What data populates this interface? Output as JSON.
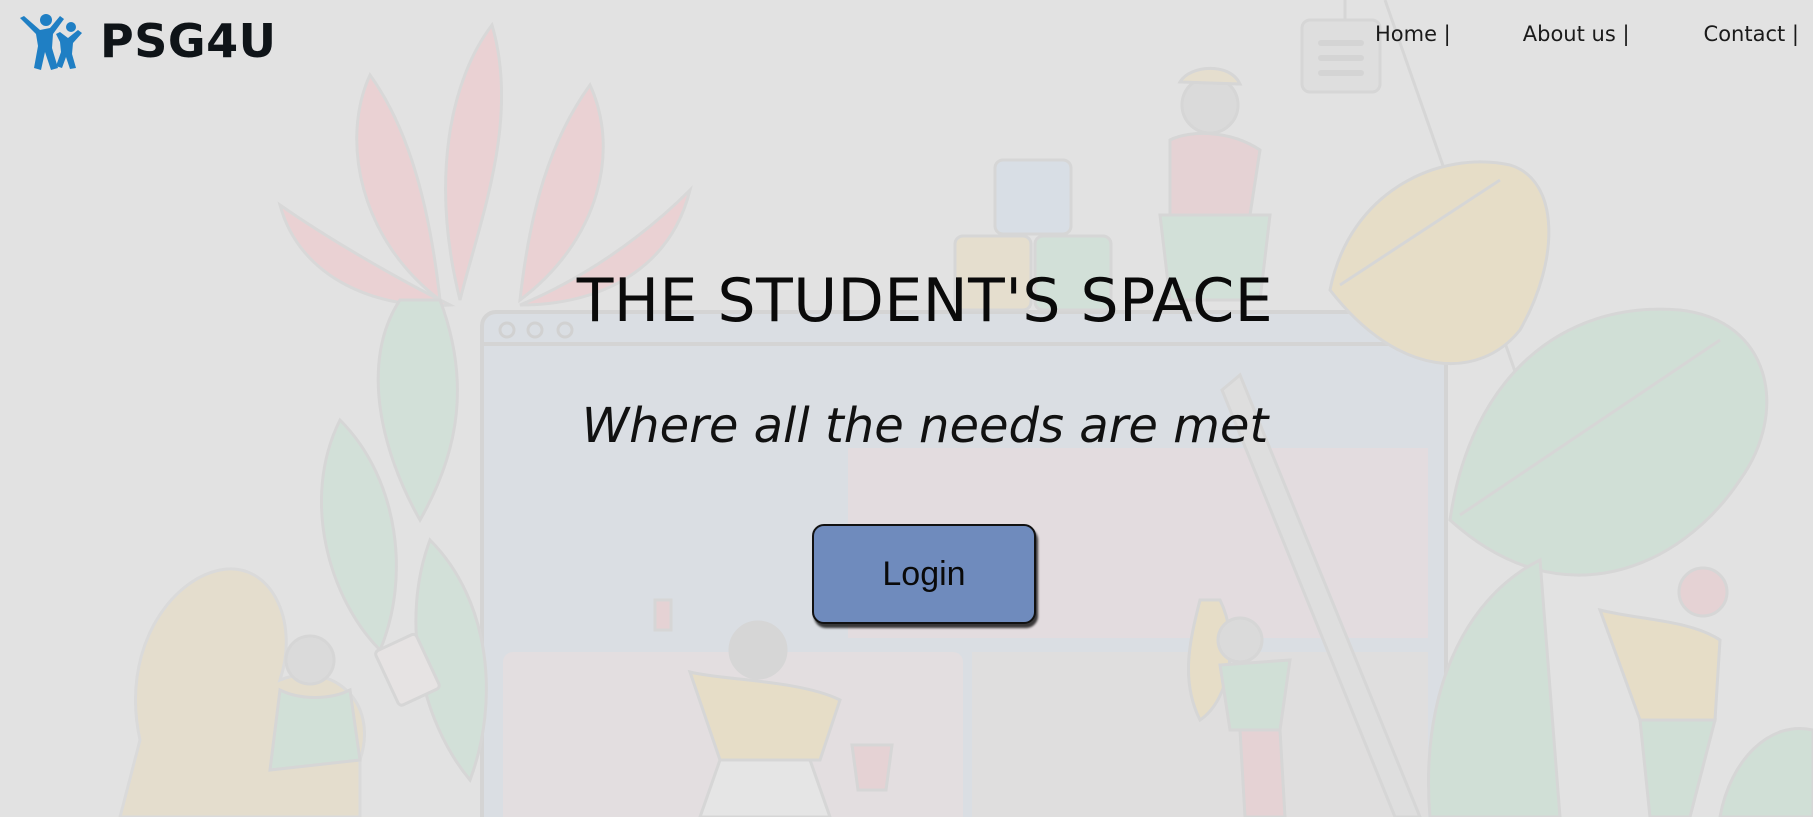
{
  "brand": {
    "name": "PSG4U",
    "icon": "two-people-jumping-icon",
    "color": "#1f7fc4"
  },
  "nav": {
    "items": [
      {
        "label": "Home |"
      },
      {
        "label": "About us |"
      },
      {
        "label": "Contact |"
      }
    ]
  },
  "hero": {
    "title": "THE STUDENT'S SPACE",
    "subtitle": "Where all the needs are met",
    "login_label": "Login"
  },
  "colors": {
    "background": "#e2e2e2",
    "button": "#6f8bbd"
  }
}
